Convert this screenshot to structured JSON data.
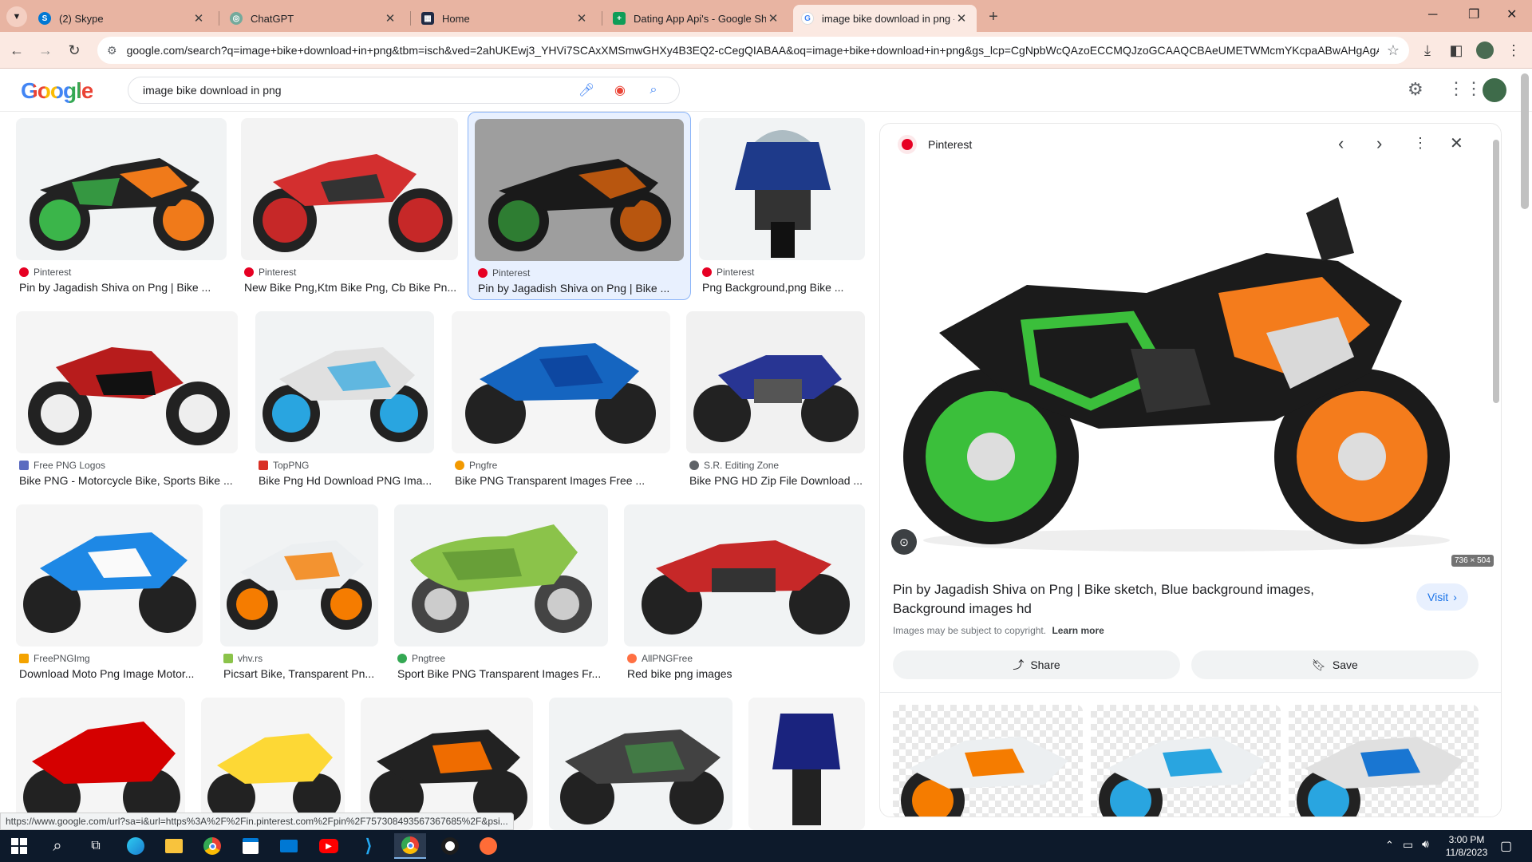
{
  "tabs": [
    {
      "title": "(2) Skype",
      "icon": "skype-icon",
      "color": "#0078d4"
    },
    {
      "title": "ChatGPT",
      "icon": "chatgpt-icon",
      "color": "#74aa9c"
    },
    {
      "title": "Home",
      "icon": "home-app-icon",
      "color": "#1f2a44"
    },
    {
      "title": "Dating App Api's - Google She",
      "icon": "sheets-icon",
      "color": "#0f9d58"
    },
    {
      "title": "image bike download in png -",
      "icon": "google-icon",
      "color": "#4285f4"
    }
  ],
  "address_bar": {
    "url": "google.com/search?q=image+bike+download+in+png&tbm=isch&ved=2ahUKEwj3_YHVi7SCAxXMSmwGHXy4B3EQ2-cCegQIABAA&oq=image+bike+download+in+png&gs_lcp=CgNpbWcQAzoECCMQJzoGCAAQCBAeUMETWMcmYKcpaABwAHgAgA..."
  },
  "google": {
    "logo": "Google",
    "query": "image bike download in png"
  },
  "results": [
    {
      "source": "Pinterest",
      "title": "Pin by Jagadish Shiva on Png | Bike ...",
      "src_color": "#e60023"
    },
    {
      "source": "Pinterest",
      "title": "New Bike Png,Ktm Bike Png, Cb Bike Pn...",
      "src_color": "#e60023"
    },
    {
      "source": "Pinterest",
      "title": "Pin by Jagadish Shiva on Png | Bike ...",
      "src_color": "#e60023"
    },
    {
      "source": "Pinterest",
      "title": "Png Background,png Bike ...",
      "src_color": "#e60023"
    },
    {
      "source": "Free PNG Logos",
      "title": "Bike PNG - Motorcycle Bike, Sports Bike ...",
      "src_color": "#5b6bc0"
    },
    {
      "source": "TopPNG",
      "title": "Bike Png Hd Download PNG Ima...",
      "src_color": "#d93025"
    },
    {
      "source": "Pngfre",
      "title": "Bike PNG Transparent Images Free ...",
      "src_color": "#f29900"
    },
    {
      "source": "S.R. Editing Zone",
      "title": "Bike PNG HD Zip File Download ...",
      "src_color": "#5f6368"
    },
    {
      "source": "FreePNGImg",
      "title": "Download Moto Png Image Motor...",
      "src_color": "#f4a300"
    },
    {
      "source": "vhv.rs",
      "title": "Picsart Bike, Transparent Pn...",
      "src_color": "#8bc34a"
    },
    {
      "source": "Pngtree",
      "title": "Sport Bike PNG Transparent Images Fr...",
      "src_color": "#34a853"
    },
    {
      "source": "AllPNGFree",
      "title": "Red bike png images",
      "src_color": "#ff7043"
    }
  ],
  "panel": {
    "source": "Pinterest",
    "dimensions": "736 × 504",
    "title": "Pin by Jagadish Shiva on Png | Bike sketch, Blue background images, Background images hd",
    "visit_label": "Visit",
    "copyright": "Images may be subject to copyright.",
    "learn_more": "Learn more",
    "share_label": "Share",
    "save_label": "Save"
  },
  "status_url": "https://www.google.com/url?sa=i&url=https%3A%2F%2Fin.pinterest.com%2Fpin%2F757308493567367685%2F&psi...",
  "taskbar": {
    "time": "3:00 PM",
    "date": "11/8/2023"
  }
}
